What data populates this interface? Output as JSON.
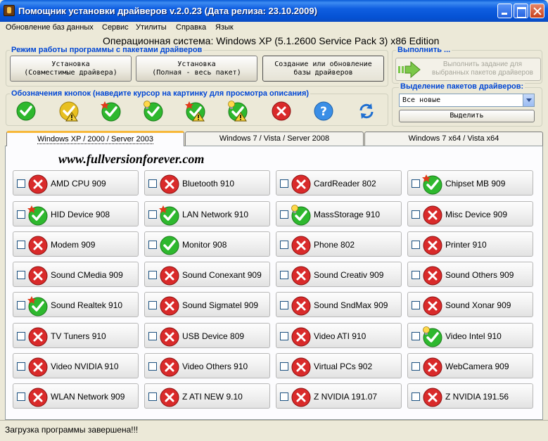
{
  "window": {
    "title": "Помощник установки драйверов v.2.0.23 (Дата релиза: 23.10.2009)"
  },
  "menu": [
    "Обновление баз данных",
    "Сервис",
    "Утилиты",
    "Справка",
    "Язык"
  ],
  "os_info": "Операционная система: Windows XP  (5.1.2600 Service Pack 3) x86 Edition",
  "mode_group": {
    "title": "Режим работы программы с пакетами драйверов",
    "buttons": [
      "Установка\n(Совместимые драйвера)",
      "Установка\n(Полная - весь пакет)",
      "Создание или обновление\nбазы драйверов"
    ]
  },
  "legend_group": {
    "title": "Обозначения кнопок (наведите курсор на картинку для просмотра описания)",
    "icons": [
      "check-icon",
      "check-warning-icon",
      "check-new-icon",
      "check-bulb-icon",
      "check-new-warning-icon",
      "check-bulb-warning-icon",
      "error-icon",
      "help-icon",
      "refresh-icon"
    ]
  },
  "execute": {
    "title": "Выполнить ...",
    "button_label": "Выполнить задание для\nвыбранных пакетов драйверов"
  },
  "selection": {
    "title": "Выделение пакетов драйверов:",
    "selected": "Все новые",
    "button_label": "Выделить"
  },
  "tabs": [
    "Windows XP / 2000 / Server 2003",
    "Windows 7 / Vista / Server 2008",
    "Windows 7 x64 / Vista x64"
  ],
  "watermark": "www.fullversionforever.com",
  "packages": [
    {
      "label": "AMD CPU 909",
      "status": "error"
    },
    {
      "label": "Bluetooth 910",
      "status": "error"
    },
    {
      "label": "CardReader 802",
      "status": "error"
    },
    {
      "label": "Chipset MB 909",
      "status": "new"
    },
    {
      "label": "HID Device 908",
      "status": "new"
    },
    {
      "label": "LAN Network 910",
      "status": "new"
    },
    {
      "label": "MassStorage 910",
      "status": "bulb"
    },
    {
      "label": "Misc Device 909",
      "status": "error"
    },
    {
      "label": "Modem 909",
      "status": "error"
    },
    {
      "label": "Monitor 908",
      "status": "ok"
    },
    {
      "label": "Phone 802",
      "status": "error"
    },
    {
      "label": "Printer 910",
      "status": "error"
    },
    {
      "label": "Sound CMedia 909",
      "status": "error"
    },
    {
      "label": "Sound Conexant 909",
      "status": "error"
    },
    {
      "label": "Sound Creativ 909",
      "status": "error"
    },
    {
      "label": "Sound Others 909",
      "status": "error"
    },
    {
      "label": "Sound Realtek 910",
      "status": "new"
    },
    {
      "label": "Sound Sigmatel 909",
      "status": "error"
    },
    {
      "label": "Sound SndMax 909",
      "status": "error"
    },
    {
      "label": "Sound Xonar 909",
      "status": "error"
    },
    {
      "label": "TV Tuners 910",
      "status": "error"
    },
    {
      "label": "USB Device 809",
      "status": "error"
    },
    {
      "label": "Video ATI 910",
      "status": "error"
    },
    {
      "label": "Video Intel 910",
      "status": "bulb"
    },
    {
      "label": "Video NVIDIA 910",
      "status": "error"
    },
    {
      "label": "Video Others 910",
      "status": "error"
    },
    {
      "label": "Virtual PCs 902",
      "status": "error"
    },
    {
      "label": "WebCamera 909",
      "status": "error"
    },
    {
      "label": "WLAN Network 909",
      "status": "error"
    },
    {
      "label": "Z ATI NEW 9.10",
      "status": "error"
    },
    {
      "label": "Z NVIDIA 191.07",
      "status": "error"
    },
    {
      "label": "Z NVIDIA 191.56",
      "status": "error"
    }
  ],
  "status_bar": "Загрузка программы завершена!!!",
  "colors": {
    "titlebar": "#0a5cd8",
    "group_title": "#0046d5",
    "ok": "#2eb82e",
    "error": "#d92a2a",
    "warning": "#e8c020",
    "help": "#3a8ee6"
  }
}
